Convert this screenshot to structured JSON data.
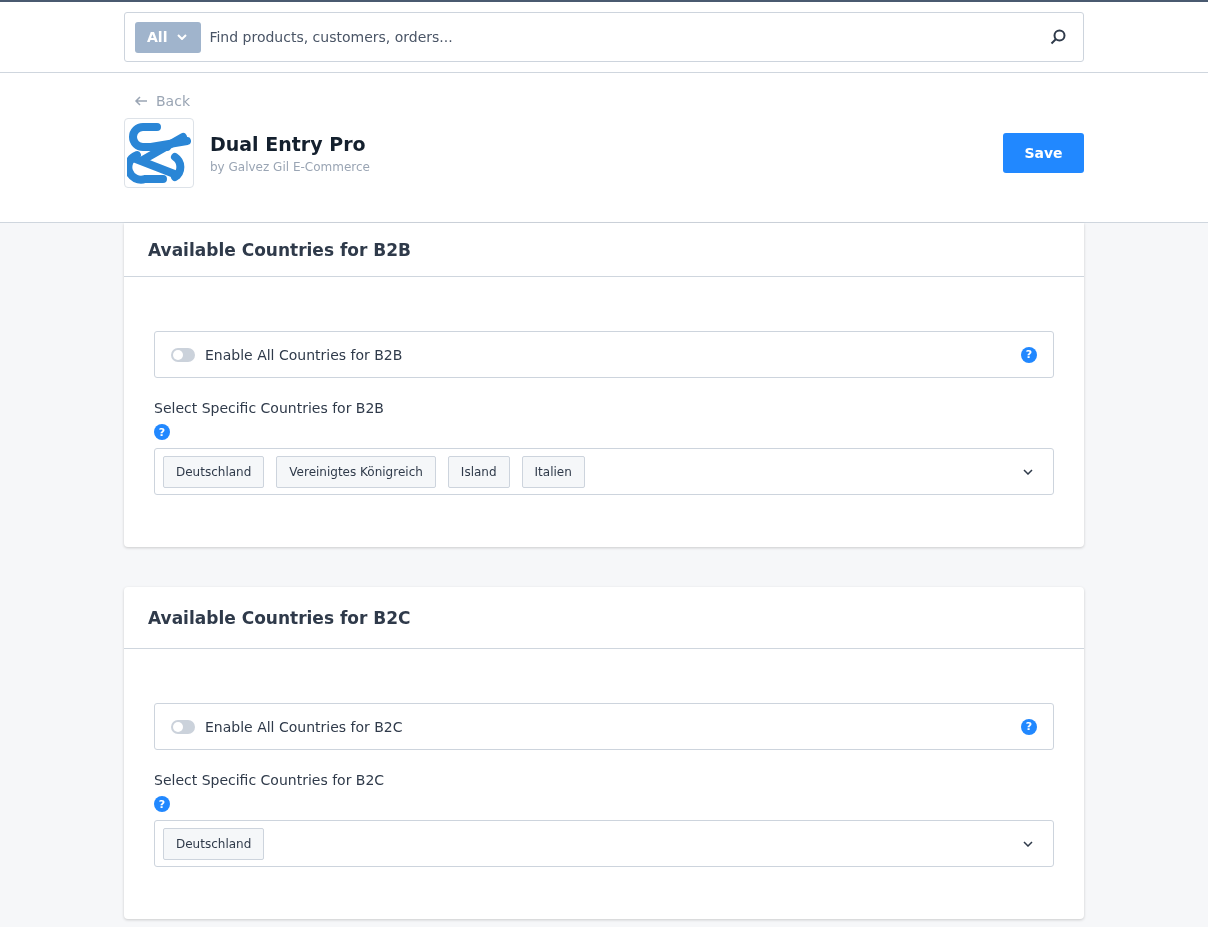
{
  "search": {
    "scope": "All",
    "placeholder": "Find products, customers, orders..."
  },
  "header": {
    "back": "Back",
    "app_name": "Dual Entry Pro",
    "vendor": "by Galvez Gil E-Commerce",
    "save": "Save"
  },
  "sections": [
    {
      "title": "Available Countries for B2B",
      "toggle": {
        "label": "Enable All Countries for B2B",
        "on": false,
        "help": "?"
      },
      "select_label": "Select Specific Countries for B2B",
      "select_help": "?",
      "countries": [
        "Deutschland",
        "Vereinigtes Königreich",
        "Island",
        "Italien"
      ]
    },
    {
      "title": "Available Countries for B2C",
      "toggle": {
        "label": "Enable All Countries for B2C",
        "on": false,
        "help": "?"
      },
      "select_label": "Select Specific Countries for B2C",
      "select_help": "?",
      "countries": [
        "Deutschland"
      ]
    }
  ]
}
